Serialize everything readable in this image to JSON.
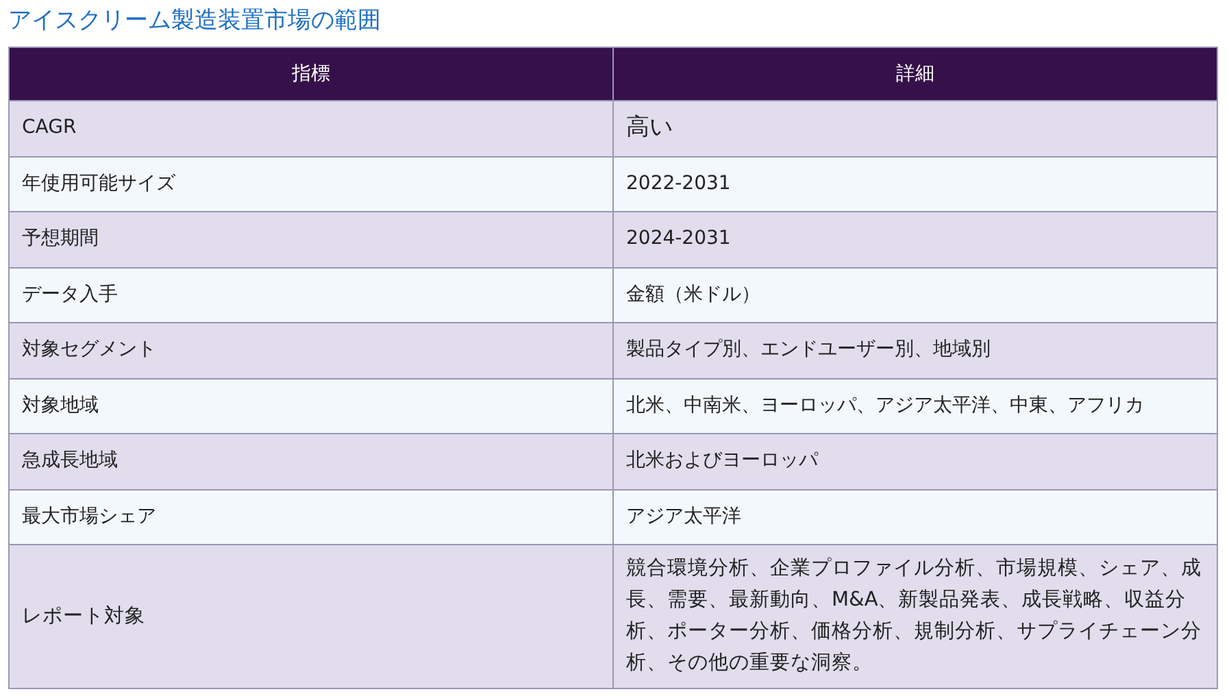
{
  "title": "アイスクリーム製造装置市場の範囲",
  "table": {
    "columns": [
      "指標",
      "詳細"
    ],
    "rows": [
      {
        "cells": [
          "CAGR",
          "高い"
        ]
      },
      {
        "cells": [
          "年使用可能サイズ",
          "2022-2031"
        ]
      },
      {
        "cells": [
          "予想期間",
          "2024-2031"
        ]
      },
      {
        "cells": [
          "データ入手",
          "金額（米ドル）"
        ]
      },
      {
        "cells": [
          "対象セグメント",
          "製品タイプ別、エンドユーザー別、地域別"
        ]
      },
      {
        "cells": [
          "対象地域",
          "北米、中南米、ヨーロッパ、アジア太平洋、中東、アフリカ"
        ]
      },
      {
        "cells": [
          "急成長地域",
          "北米およびヨーロッパ"
        ]
      },
      {
        "cells": [
          "最大市場シェア",
          "アジア太平洋"
        ]
      },
      {
        "cells": [
          "レポート対象",
          "競合環境分析、企業プロファイル分析、市場規模、シェア、成長、需要、最新動向、M&A、新製品発表、成長戦略、収益分析、ポーター分析、価格分析、規制分析、サプライチェーン分析、その他の重要な洞察。"
        ]
      }
    ]
  }
}
